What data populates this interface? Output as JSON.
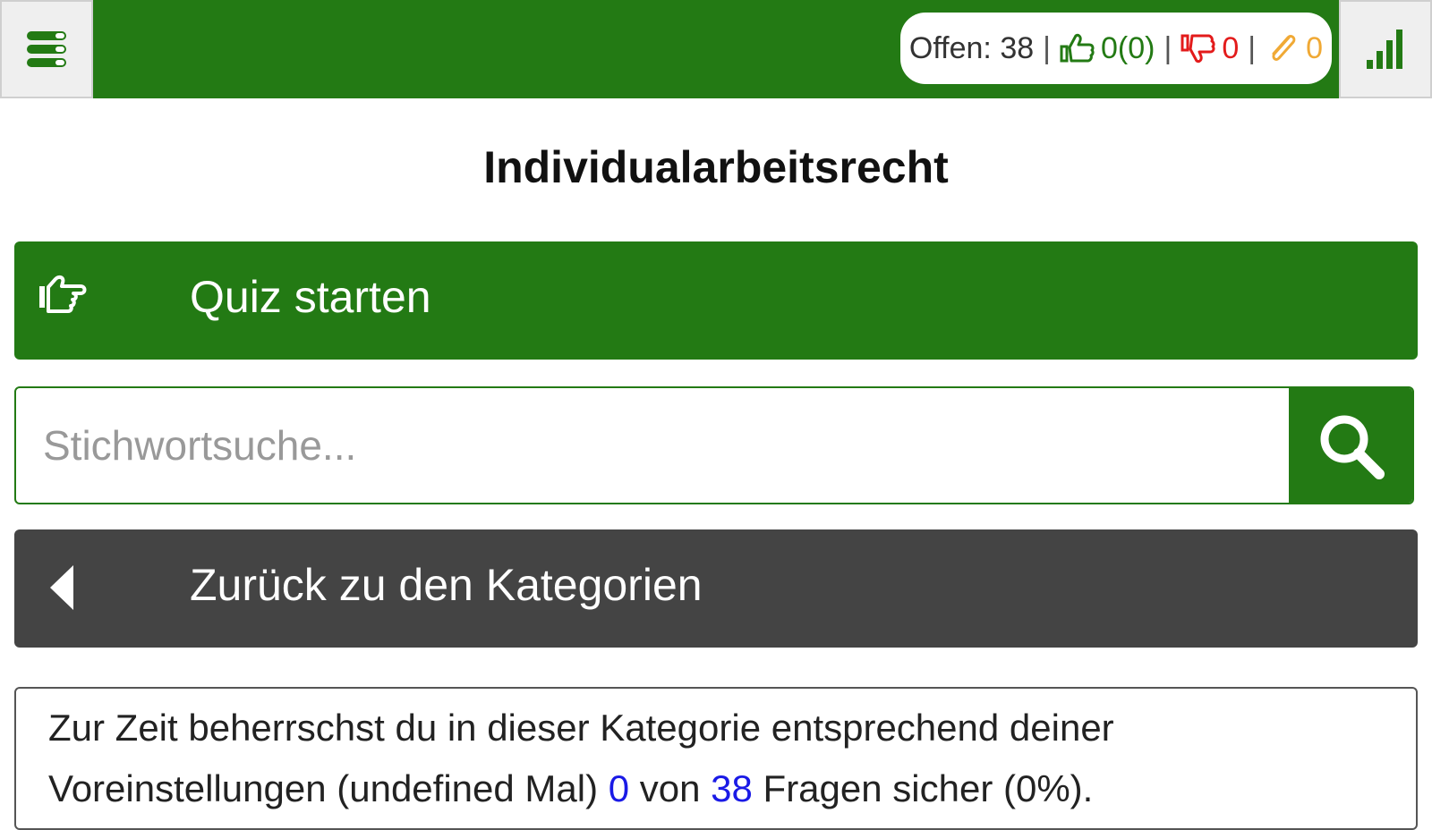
{
  "header": {
    "stats": {
      "open_label": "Offen: 38",
      "correct_value": "0(0)",
      "wrong_value": "0",
      "marked_value": "0",
      "separator": "|"
    }
  },
  "page": {
    "title": "Individualarbeitsrecht"
  },
  "quiz_button": {
    "label": "Quiz starten"
  },
  "search": {
    "placeholder": "Stichwortsuche..."
  },
  "back_button": {
    "label": "Zurück zu den Kategorien"
  },
  "info": {
    "line1": "Zur Zeit beherrschst du in dieser Kategorie entsprechend deiner",
    "line2_prefix": "Voreinstellungen (undefined Mal) ",
    "mastered": "0",
    "middle": " von ",
    "total": "38",
    "line2_suffix": " Fragen sicher (0%)."
  },
  "colors": {
    "brand_green": "#237a14",
    "back_gray": "#444444",
    "wrong_red": "#e31b1b",
    "marked_orange": "#f0a935",
    "highlight_blue": "#1a1ae6"
  },
  "icons": {
    "menu": "menu-icon",
    "signal": "signal-bars-icon",
    "thumbs_up": "thumbs-up-icon",
    "thumbs_down": "thumbs-down-icon",
    "paperclip": "paperclip-icon",
    "pointing_hand": "pointing-hand-icon",
    "search": "search-icon",
    "back": "caret-left-icon"
  }
}
